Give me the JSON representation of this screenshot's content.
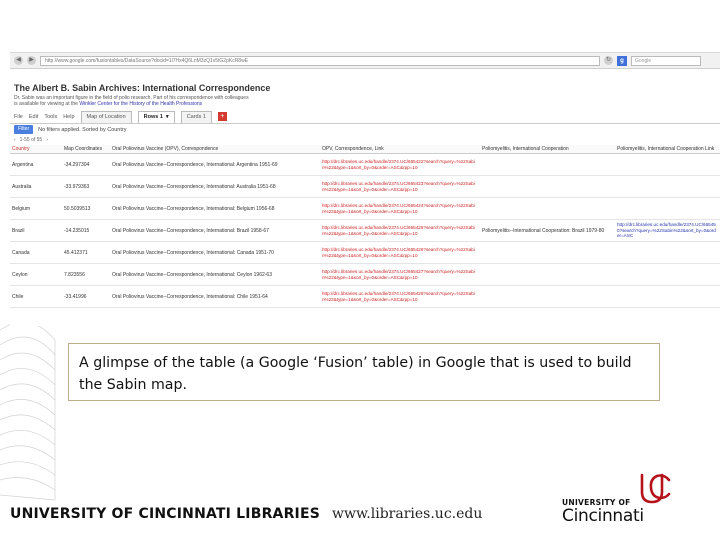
{
  "browser": {
    "url": "http://www.google.com/fusiontables/DataSource?docid=1l7Hx4Q6LnM3zQ1v5tG2pKcR8wE",
    "search_placeholder": "Google",
    "search_badge": "g"
  },
  "fusion": {
    "title": "The Albert B. Sabin Archives: International Correspondence",
    "description_line1": "Dr. Sabin was an important figure in the field of polio research. Part of his correspondence with colleagues",
    "description_line2": "is available for viewing at the",
    "description_link": "Winkler Center for the History of the Health Professions",
    "menu": [
      "File",
      "Edit",
      "Tools",
      "Help"
    ],
    "tabs": [
      {
        "label": "Map of Location",
        "active": false
      },
      {
        "label": "Rows 1",
        "active": true
      },
      {
        "label": "Cards 1",
        "active": false
      }
    ],
    "add_tab": "+",
    "filter_button": "Filter",
    "filter_text": "No filters applied. Sorted by Country",
    "rows_text": "1-55 of 55"
  },
  "table": {
    "headers": [
      "Country",
      "Map Coordinates",
      "Oral Poliovirus Vaccine (OPV), Correspondence",
      "OPV, Correspondence, Link",
      "Poliomyelitis, International Cooperation",
      "Poliomyelitis, International Cooperation Link"
    ],
    "rows": [
      [
        "Argentina",
        "-34.297304",
        "Oral Poliovirus Vaccine--Correspondence, International: Argentina 1951-69",
        "http://drc.libraries.uc.edu/handle/2374.UC/665422?search?query=%22Sabin%22&type=1&sort_by=0&order=ASC&rpp=10",
        "",
        ""
      ],
      [
        "Australia",
        "-33.979363",
        "Oral Poliovirus Vaccine--Correspondence, International: Australia 1951-68",
        "http://drc.libraries.uc.edu/handle/2374.UC/665423?search?query=%22Sabin%22&type=1&sort_by=0&order=ASC&rpp=10",
        "",
        ""
      ],
      [
        "Belgium",
        "50.5039513",
        "Oral Poliovirus Vaccine--Correspondence, International: Belgium 1956-68",
        "http://drc.libraries.uc.edu/handle/2374.UC/665424?search?query=%22Sabin%22&type=1&sort_by=0&order=ASC&rpp=10",
        "",
        ""
      ],
      [
        "Brazil",
        "-14.235015",
        "Oral Poliovirus Vaccine--Correspondence, International: Brazil 1958-67",
        "http://drc.libraries.uc.edu/handle/2374.UC/665425?search?query=%22Sabin%22&type=1&sort_by=0&order=ASC&rpp=10",
        "Poliomyelitis--International Cooperation: Brazil 1979-80",
        "http://drc.libraries.uc.edu/handle/2374.UC/665450?search?query=%22Sabin%22&sort_by=0&order=ASC"
      ],
      [
        "Canada",
        "45.412371",
        "Oral Poliovirus Vaccine--Correspondence, International: Canada 1951-70",
        "http://drc.libraries.uc.edu/handle/2374.UC/665426?search?query=%22Sabin%22&type=1&sort_by=0&order=ASC&rpp=10",
        "",
        ""
      ],
      [
        "Ceylon",
        "7.823556",
        "Oral Poliovirus Vaccine--Correspondence, International: Ceylon 1962-63",
        "http://drc.libraries.uc.edu/handle/2374.UC/665427?search?query=%22Sabin%22&type=1&sort_by=0&order=ASC&rpp=10",
        "",
        ""
      ],
      [
        "Chile",
        "-33.41996",
        "Oral Poliovirus Vaccine--Correspondence, International: Chile 1951-64",
        "http://drc.libraries.uc.edu/handle/2374.UC/665428?search?query=%22Sabin%22&type=1&sort_by=0&order=ASC&rpp=10",
        "",
        ""
      ]
    ]
  },
  "caption": "A glimpse of the table (a Google ‘Fusion’ table) in Google that is used to build the Sabin map.",
  "footer": {
    "library": "UNIVERSITY OF CINCINNATI LIBRARIES",
    "url": "www.libraries.uc.edu"
  },
  "logo": {
    "university": "UNIVERSITY OF",
    "name": "Cincinnati",
    "mark_color": "#b5121b"
  }
}
